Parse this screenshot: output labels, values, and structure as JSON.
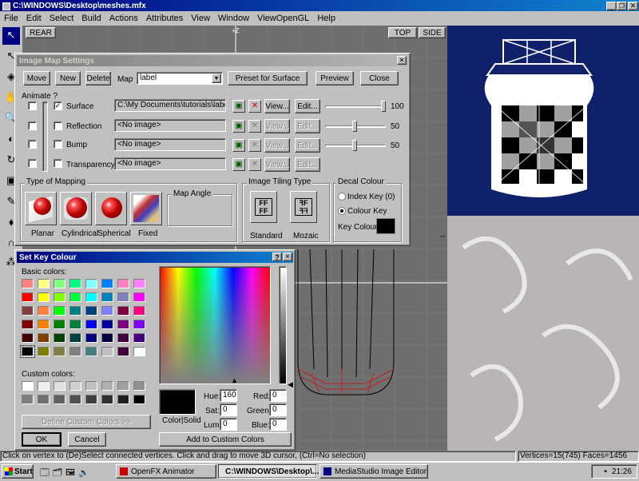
{
  "window": {
    "title": "C:\\WINDOWS\\Desktop\\meshes.mfx"
  },
  "menu": [
    "File",
    "Edit",
    "Select",
    "Build",
    "Actions",
    "Attributes",
    "View",
    "Window",
    "ViewOpenGL",
    "Help"
  ],
  "viewports": {
    "rear": "REAR",
    "top": "TOP",
    "side": "SIDE",
    "axis_z": "+Z"
  },
  "imap": {
    "title": "Image Map Settings",
    "move": "Move",
    "new": "New",
    "delete": "Delete",
    "map_label": "Map",
    "map_value": "label",
    "preset": "Preset for Surface",
    "preview": "Preview",
    "close": "Close",
    "animate": "Animate ?",
    "rows": [
      {
        "name": "Surface",
        "checked": true,
        "path": "C:\\My Documents\\tutorials\\label.gif",
        "value": "100",
        "view": "View...",
        "edit": "Edit..."
      },
      {
        "name": "Reflection",
        "checked": false,
        "path": "<No image>",
        "value": "50",
        "view": "View...",
        "edit": "Edit..."
      },
      {
        "name": "Bump",
        "checked": false,
        "path": "<No image>",
        "value": "50",
        "view": "View...",
        "edit": "Edit..."
      },
      {
        "name": "Transparency",
        "checked": false,
        "path": "<No image>",
        "value": "",
        "view": "View...",
        "edit": "Edit..."
      }
    ],
    "type_of_mapping": "Type of Mapping",
    "mappings": [
      "Planar",
      "Cylindrical",
      "Spherical",
      "Fixed"
    ],
    "map_angle": "Map Angle",
    "tiling": "Image Tiling Type",
    "tiling_opts": [
      "Standard",
      "Mozaic"
    ],
    "decal": "Decal Colour",
    "index_key": "Index Key (0)",
    "colour_key": "Colour Key",
    "key_colour": "Key Colour"
  },
  "colordlg": {
    "title": "Set Key Colour",
    "help": "?",
    "closex": "×",
    "basic": "Basic colors:",
    "basic_colors": [
      "#ff8080",
      "#ffff80",
      "#80ff80",
      "#00ff80",
      "#80ffff",
      "#0080ff",
      "#ff80c0",
      "#ff80ff",
      "#ff0000",
      "#ffff00",
      "#80ff00",
      "#00ff40",
      "#00ffff",
      "#0080c0",
      "#8080c0",
      "#ff00ff",
      "#804040",
      "#ff8040",
      "#00ff00",
      "#008080",
      "#004080",
      "#8080ff",
      "#800040",
      "#ff0080",
      "#800000",
      "#ff8000",
      "#008000",
      "#008040",
      "#0000ff",
      "#0000a0",
      "#800080",
      "#8000ff",
      "#400000",
      "#804000",
      "#004000",
      "#004040",
      "#000080",
      "#000040",
      "#400040",
      "#400080",
      "#000000",
      "#808000",
      "#808040",
      "#808080",
      "#408080",
      "#c0c0c0",
      "#400040",
      "#ffffff"
    ],
    "custom": "Custom colors:",
    "custom_colors": [
      "#ffffff",
      "#f0f0f0",
      "#e0e0e0",
      "#d0d0d0",
      "#c0c0c0",
      "#b0b0b0",
      "#a0a0a0",
      "#909090",
      "#808080",
      "#707070",
      "#606060",
      "#505050",
      "#404040",
      "#303030",
      "#202020",
      "#000000"
    ],
    "define": "Define Custom Colors >>",
    "ok": "OK",
    "cancel": "Cancel",
    "colorsolid": "Color|Solid",
    "hue_l": "Hue:",
    "hue": "160",
    "sat_l": "Sat:",
    "sat": "0",
    "lum_l": "Lum:",
    "lum": "0",
    "red_l": "Red:",
    "red": "0",
    "green_l": "Green:",
    "green": "0",
    "blue_l": "Blue:",
    "blue": "0",
    "add": "Add to Custom Colors"
  },
  "status": {
    "left": "Click on vertex to (De)Select connected vertices. Click and drag to move 3D cursor, (Ctrl=No selection)",
    "right": "Vertices=15(745) Faces=1456"
  },
  "taskbar": {
    "start": "Start",
    "tasks": [
      "OpenFX Animator",
      "C:\\WINDOWS\\Desktop\\...",
      "MediaStudio Image Editor"
    ],
    "time": "21:26"
  },
  "colors": {
    "title_active": "#000080",
    "viewport_gray": "#6e6e6e",
    "preview_bg": "#10216b",
    "key_colour": "#000000"
  }
}
